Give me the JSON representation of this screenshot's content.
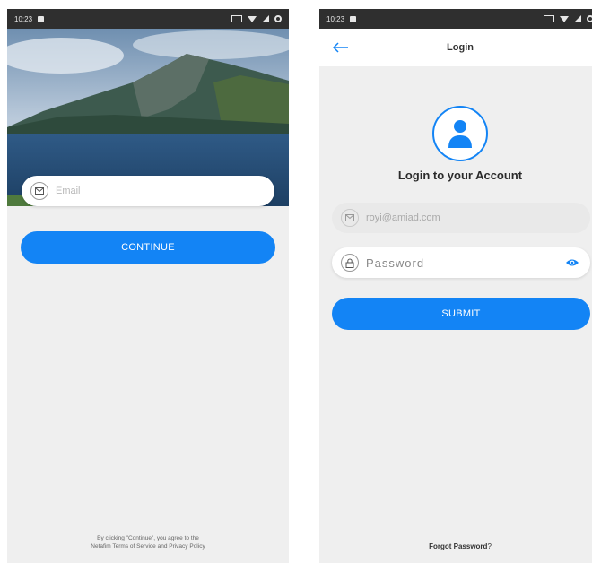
{
  "status_bar": {
    "time": "10:23"
  },
  "email_screen": {
    "email_placeholder": "Email",
    "continue_label": "CONTINUE",
    "terms_line1": "By clicking \"Continue\", you agree to the",
    "terms_line2": "Netafim Terms of Service and Privacy Policy"
  },
  "login_screen": {
    "title": "Login",
    "heading": "Login to your Account",
    "email_value": "royi@amiad.com",
    "password_placeholder": "Password",
    "submit_label": "SUBMIT",
    "forgot_label": "Forgot Password",
    "forgot_suffix": "?"
  },
  "colors": {
    "accent": "#1384f5",
    "background": "#efefef"
  },
  "icons": [
    "mail-icon",
    "lock-icon",
    "eye-icon",
    "back-arrow-icon",
    "user-icon"
  ]
}
